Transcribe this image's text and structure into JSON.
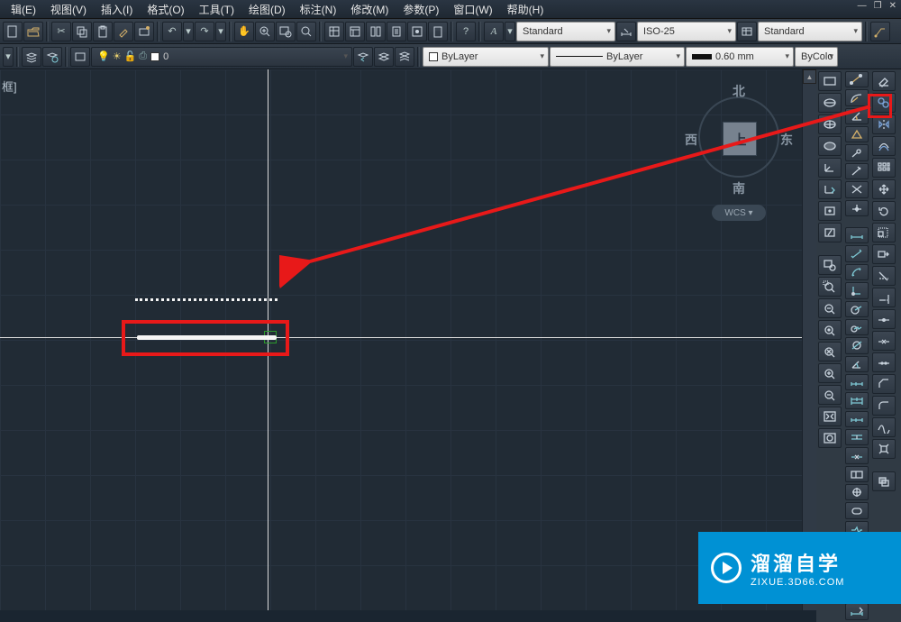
{
  "menu": {
    "items": [
      "辑(E)",
      "视图(V)",
      "插入(I)",
      "格式(O)",
      "工具(T)",
      "绘图(D)",
      "标注(N)",
      "修改(M)",
      "参数(P)",
      "窗口(W)",
      "帮助(H)"
    ]
  },
  "window_ctl": {
    "min": "—",
    "restore": "❐",
    "close": "✕"
  },
  "toolbar1": {
    "text_style": "Standard",
    "dim_style": "ISO-25",
    "table_style": "Standard"
  },
  "toolbar2": {
    "layer_current": "0",
    "layer_dd": "ByLayer",
    "linetype_dd": "ByLayer",
    "lineweight_dd": "0.60 mm",
    "color_dd": "ByColo"
  },
  "canvas": {
    "label": "框]"
  },
  "viewcube": {
    "n": "北",
    "s": "南",
    "e": "东",
    "w": "西",
    "top": "上",
    "wcs": "WCS ▾"
  },
  "watermark": {
    "title": "溜溜自学",
    "url": "ZIXUE.3D66.COM"
  }
}
